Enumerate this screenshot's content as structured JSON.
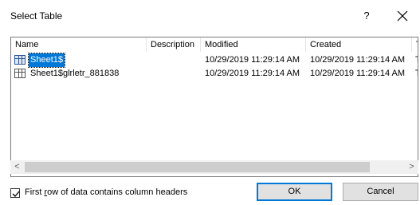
{
  "dialog": {
    "title": "Select Table",
    "help_label": "?"
  },
  "columns": [
    "Name",
    "Description",
    "Modified",
    "Created",
    "T"
  ],
  "rows": [
    {
      "name": "Sheet1$",
      "description": "",
      "modified": "10/29/2019 11:29:14 AM",
      "created": "10/29/2019 11:29:14 AM",
      "type": "T",
      "selected": true
    },
    {
      "name": "Sheet1$glrletr_881838",
      "description": "",
      "modified": "10/29/2019 11:29:14 AM",
      "created": "10/29/2019 11:29:14 AM",
      "type": "T",
      "selected": false
    }
  ],
  "scrollbar": {
    "left_arrow": "<",
    "right_arrow": ">"
  },
  "options": {
    "first_row_headers_prefix": "First ",
    "first_row_headers_accel": "r",
    "first_row_headers_suffix": "ow of data contains column headers",
    "first_row_headers_checked": true
  },
  "buttons": {
    "ok": "OK",
    "cancel": "Cancel"
  },
  "colors": {
    "selection": "#0078d7",
    "default_button_border": "#0078d7"
  }
}
